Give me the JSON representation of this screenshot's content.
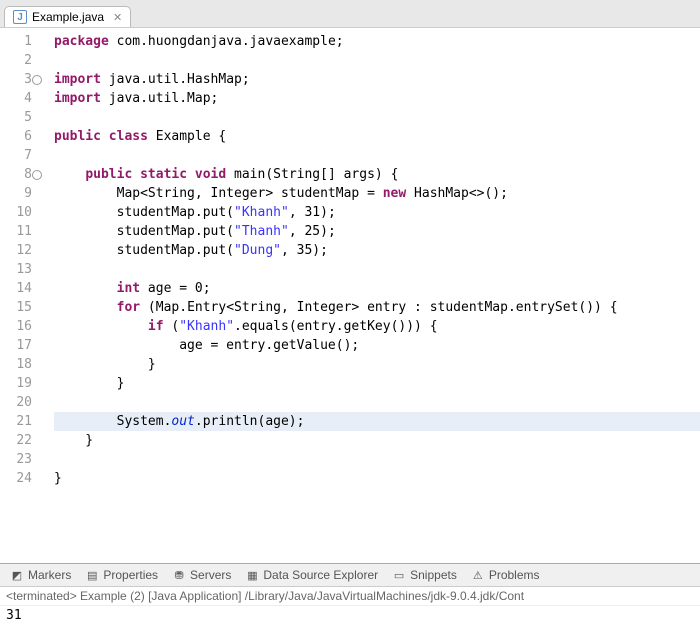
{
  "tab": {
    "filename": "Example.java",
    "icon_letter": "J"
  },
  "code": {
    "lines": [
      {
        "n": 1,
        "html": "<span class='kw'>package</span> <span class='pkg'>com.huongdanjava.javaexample;</span>"
      },
      {
        "n": 2,
        "html": ""
      },
      {
        "n": 3,
        "html": "<span class='kw'>import</span> java.util.HashMap;",
        "fold": true
      },
      {
        "n": 4,
        "html": "<span class='kw'>import</span> java.util.Map;"
      },
      {
        "n": 5,
        "html": ""
      },
      {
        "n": 6,
        "html": "<span class='kw'>public class</span> Example {"
      },
      {
        "n": 7,
        "html": ""
      },
      {
        "n": 8,
        "html": "    <span class='kw'>public static void</span> main(String[] args) {",
        "fold": true
      },
      {
        "n": 9,
        "html": "        Map&lt;String, Integer&gt; studentMap = <span class='kw'>new</span> HashMap&lt;&gt;();"
      },
      {
        "n": 10,
        "html": "        studentMap.put(<span class='str'>\"Khanh\"</span>, 31);"
      },
      {
        "n": 11,
        "html": "        studentMap.put(<span class='str'>\"Thanh\"</span>, 25);"
      },
      {
        "n": 12,
        "html": "        studentMap.put(<span class='str'>\"Dung\"</span>, 35);"
      },
      {
        "n": 13,
        "html": ""
      },
      {
        "n": 14,
        "html": "        <span class='kw'>int</span> age = 0;"
      },
      {
        "n": 15,
        "html": "        <span class='kw'>for</span> (Map.Entry&lt;String, Integer&gt; entry : studentMap.entrySet()) {"
      },
      {
        "n": 16,
        "html": "            <span class='kw'>if</span> (<span class='str'>\"Khanh\"</span>.equals(entry.getKey())) {"
      },
      {
        "n": 17,
        "html": "                age = entry.getValue();"
      },
      {
        "n": 18,
        "html": "            }"
      },
      {
        "n": 19,
        "html": "        }"
      },
      {
        "n": 20,
        "html": ""
      },
      {
        "n": 21,
        "html": "        System.<span class='field'>out</span>.println(age);",
        "hl": true
      },
      {
        "n": 22,
        "html": "    }"
      },
      {
        "n": 23,
        "html": ""
      },
      {
        "n": 24,
        "html": "}"
      }
    ]
  },
  "views": [
    {
      "label": "Markers",
      "icon": "◩"
    },
    {
      "label": "Properties",
      "icon": "▤"
    },
    {
      "label": "Servers",
      "icon": "⛃"
    },
    {
      "label": "Data Source Explorer",
      "icon": "▦"
    },
    {
      "label": "Snippets",
      "icon": "▭"
    },
    {
      "label": "Problems",
      "icon": "⚠"
    }
  ],
  "console": {
    "status": "<terminated> Example (2) [Java Application] /Library/Java/JavaVirtualMachines/jdk-9.0.4.jdk/Cont",
    "output": "31"
  }
}
